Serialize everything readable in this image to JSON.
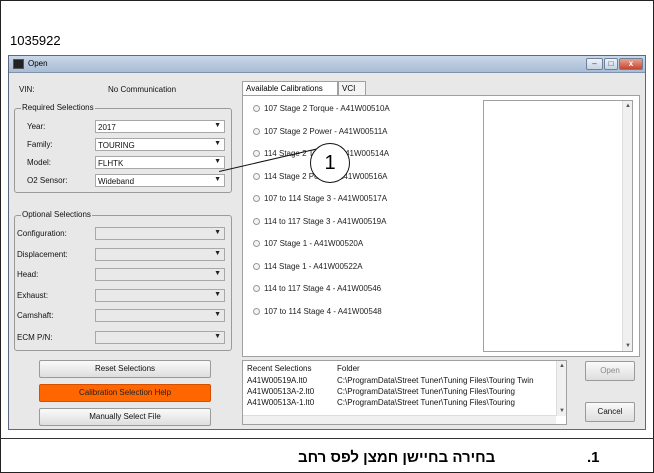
{
  "figure_id": "1035922",
  "window": {
    "title": "Open",
    "min_glyph": "–",
    "max_glyph": "□",
    "close_glyph": "x"
  },
  "left": {
    "vin_label": "VIN:",
    "vin_value": "No Communication",
    "required": {
      "title": "Required Selections",
      "fields": [
        {
          "label": "Year:",
          "value": "2017"
        },
        {
          "label": "Family:",
          "value": "TOURING"
        },
        {
          "label": "Model:",
          "value": "FLHTK"
        },
        {
          "label": "O2 Sensor:",
          "value": "Wideband"
        }
      ]
    },
    "optional": {
      "title": "Optional Selections",
      "fields": [
        {
          "label": "Configuration:",
          "value": ""
        },
        {
          "label": "Displacement:",
          "value": ""
        },
        {
          "label": "Head:",
          "value": ""
        },
        {
          "label": "Exhaust:",
          "value": ""
        },
        {
          "label": "Camshaft:",
          "value": ""
        },
        {
          "label": "ECM P/N:",
          "value": ""
        }
      ]
    },
    "buttons": {
      "reset": "Reset Selections",
      "help": "Calibration Selection Help",
      "manual": "Manually Select File"
    },
    "dropdown_glyph": "▼"
  },
  "tabs": [
    {
      "label": "Available Calibrations"
    },
    {
      "label": "VCI"
    }
  ],
  "calibrations": [
    "107 Stage 2 Torque - A41W00510A",
    "107 Stage 2 Power - A41W00511A",
    "114 Stage 2 Torque - A41W00514A",
    "114 Stage 2 Power - A41W00516A",
    "107 to 114 Stage 3 - A41W00517A",
    "114 to 117 Stage 3 - A41W00519A",
    "107 Stage 1 - A41W00520A",
    "114 Stage 1 - A41W00522A",
    "114 to 117 Stage 4 - A41W00546",
    "107 to 114 Stage 4 - A41W00548"
  ],
  "recent": {
    "col1": "Recent Selections",
    "col2": "Folder",
    "rows": [
      {
        "file": "A41W00519A.lt0",
        "folder": "C:\\ProgramData\\Street Tuner\\Tuning Files\\Touring Twin"
      },
      {
        "file": "A41W00513A-2.lt0",
        "folder": "C:\\ProgramData\\Street Tuner\\Tuning Files\\Touring"
      },
      {
        "file": "A41W00513A-1.lt0",
        "folder": "C:\\ProgramData\\Street Tuner\\Tuning Files\\Touring"
      }
    ]
  },
  "actions": {
    "open": "Open",
    "cancel": "Cancel"
  },
  "callout": "1",
  "caption": {
    "number": ".1",
    "text": "בחירה בחיישן חמצן לפס רחב"
  }
}
